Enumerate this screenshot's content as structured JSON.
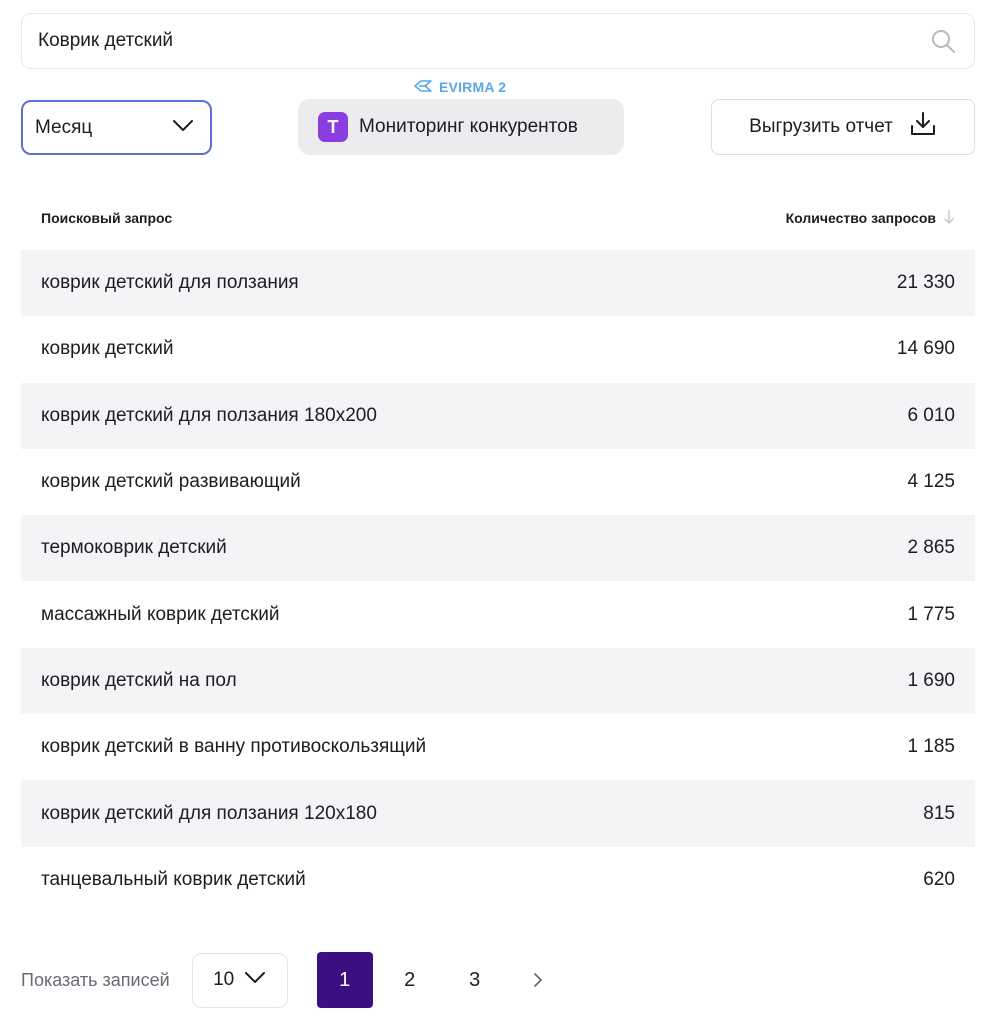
{
  "search": {
    "value": "Коврик детский",
    "icon": "search-icon"
  },
  "period_select": {
    "value": "Месяц",
    "icon": "chevron-down-icon"
  },
  "evirma_label": "EVIRMA 2",
  "monitoring_button": {
    "badge": "T",
    "label": "Мониторинг конкурентов",
    "badge_color": "#8a3de0"
  },
  "export_button": {
    "label": "Выгрузить отчет",
    "icon": "download-icon"
  },
  "table": {
    "columns": {
      "query": "Поисковый запрос",
      "count": "Количество запросов"
    },
    "rows": [
      {
        "query": "коврик детский для ползания",
        "count": "21 330"
      },
      {
        "query": "коврик детский",
        "count": "14 690"
      },
      {
        "query": "коврик детский для ползания 180х200",
        "count": "6 010"
      },
      {
        "query": "коврик детский развивающий",
        "count": "4 125"
      },
      {
        "query": "термоковрик детский",
        "count": "2 865"
      },
      {
        "query": "массажный коврик детский",
        "count": "1 775"
      },
      {
        "query": "коврик детский на пол",
        "count": "1 690"
      },
      {
        "query": "коврик детский в ванну противоскользящий",
        "count": "1 185"
      },
      {
        "query": "коврик детский для ползания 120х180",
        "count": "815"
      },
      {
        "query": "танцевальный коврик детский",
        "count": "620"
      }
    ]
  },
  "pagination": {
    "label": "Показать записей",
    "page_size": "10",
    "pages": [
      "1",
      "2",
      "3"
    ],
    "active_page": "1",
    "active_color": "#3b0f82"
  }
}
